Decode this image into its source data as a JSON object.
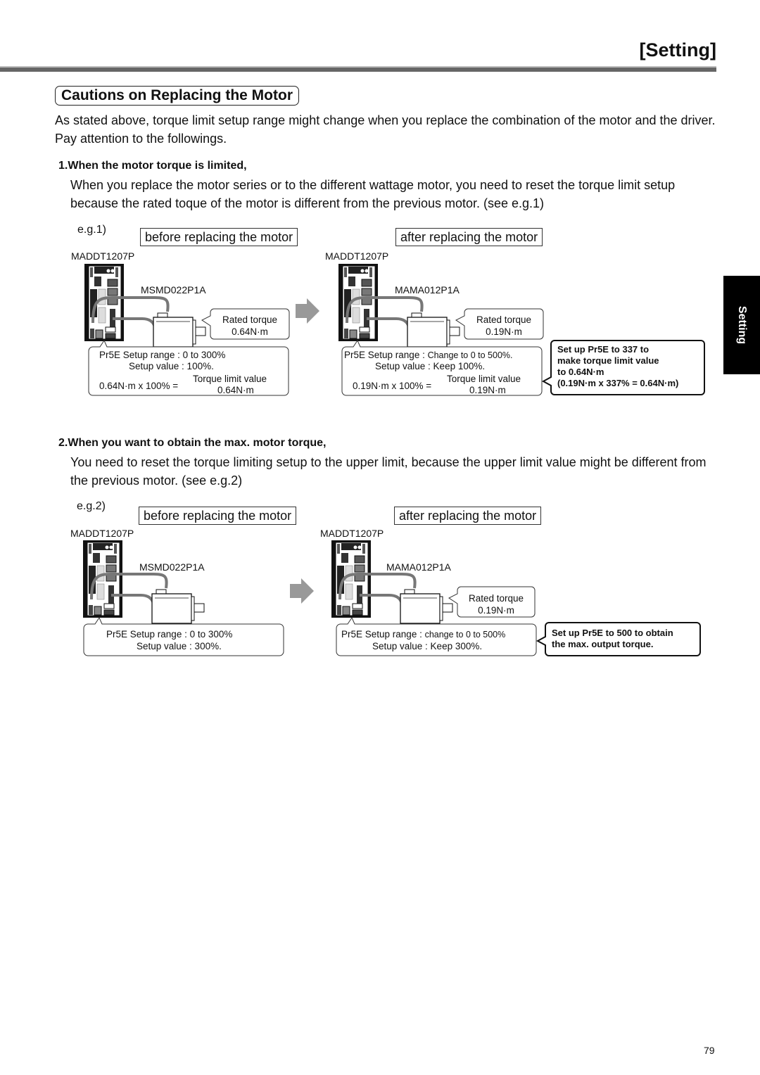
{
  "header": {
    "title": "[Setting]"
  },
  "section": {
    "title": "Cautions on Replacing the Motor",
    "intro": "As stated above, torque limit setup range might change when you replace the combination of the motor and the driver. Pay attention to the followings."
  },
  "items": [
    {
      "heading": "1.When the motor torque is limited,",
      "body": "When you replace the motor series or to the different wattage motor, you need to reset the torque limit setup because the rated toque of the motor is different from the previous motor.  (see e.g.1)",
      "example": {
        "label": "e.g.1)",
        "before": {
          "caption": "before replacing the motor",
          "driver": "MADDT1207P",
          "motor": "MSMD022P1A",
          "rated_torque_label": "Rated torque",
          "rated_torque_value": "0.64N·m",
          "param_line1": "Pr5E  Setup range :  0 to 300%",
          "param_line2": "Setup value : 100%.",
          "calc_left": "0.64N·m x 100% =",
          "calc_top": "Torque limit value",
          "calc_bottom": "0.64N·m"
        },
        "after": {
          "caption": "after replacing the motor",
          "driver": "MADDT1207P",
          "motor": "MAMA012P1A",
          "rated_torque_label": "Rated torque",
          "rated_torque_value": "0.19N·m",
          "param_line1_a": "Pr5E  Setup range : ",
          "param_line1_b": "Change to 0 to 500%.",
          "param_line2": "Setup value : Keep 100%.",
          "calc_left": "0.19N·m x 100% =",
          "calc_top": "Torque limit value",
          "calc_bottom": "0.19N·m"
        },
        "note": [
          "Set up Pr5E to 337 to",
          "make torque limit value",
          "to 0.64N·m",
          "(0.19N·m x 337% = 0.64N·m)"
        ]
      }
    },
    {
      "heading": "2.When you want to obtain the max. motor torque,",
      "body": "You need to reset the torque limiting setup to the upper limit, because the upper limit value might be different from the previous motor. (see e.g.2)",
      "example": {
        "label": "e.g.2)",
        "before": {
          "caption": "before replacing the motor",
          "driver": "MADDT1207P",
          "motor": "MSMD022P1A",
          "param_line1": "Pr5E  Setup range : 0 to 300%",
          "param_line2": "Setup value : 300%."
        },
        "after": {
          "caption": "after replacing the motor",
          "driver": "MADDT1207P",
          "motor": "MAMA012P1A",
          "rated_torque_label": "Rated torque",
          "rated_torque_value": "0.19N·m",
          "param_line1_a": "Pr5E  Setup range : ",
          "param_line1_b": "change to 0 to 500%",
          "param_line2": "Setup value : Keep 300%."
        },
        "note": [
          "Set up Pr5E to 500 to obtain",
          "the max. output torque."
        ]
      }
    }
  ],
  "side_tab": {
    "label": "Setting"
  },
  "footer": {
    "page_number": "79"
  }
}
